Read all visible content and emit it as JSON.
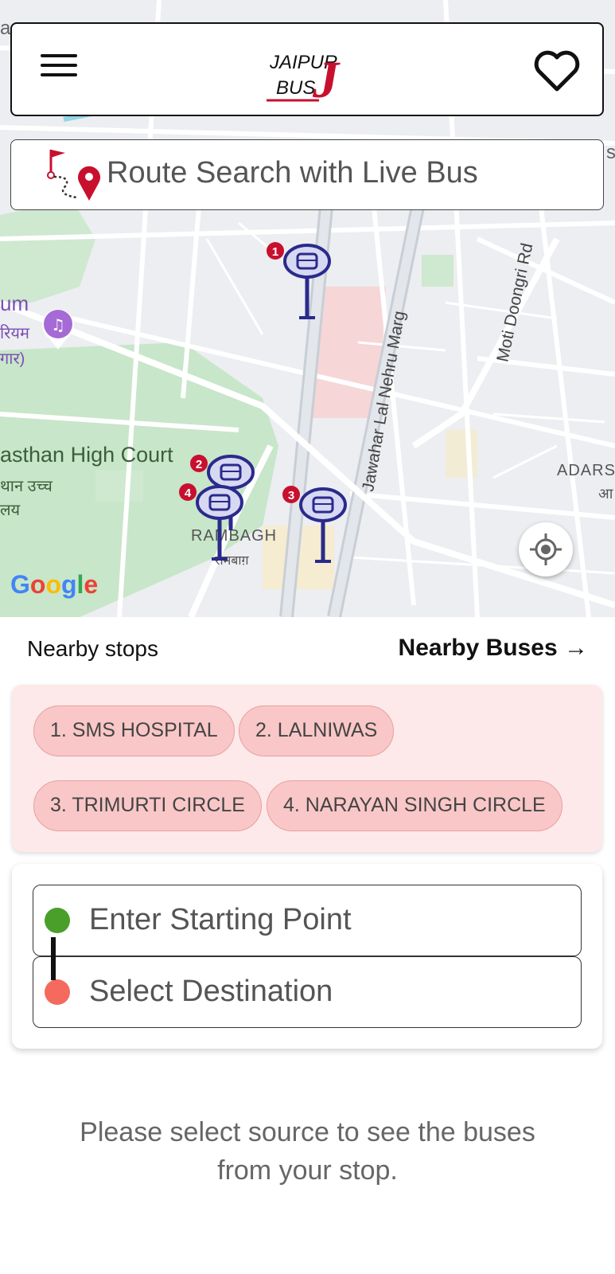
{
  "header": {
    "menu_icon": "hamburger-menu-icon",
    "logo_line1": "JAIPUR",
    "logo_line2": "BUS",
    "logo_mark": "J",
    "favorite_icon": "heart-icon"
  },
  "search": {
    "label": "Route Search with Live Bus",
    "icon": "route-pin-icon"
  },
  "map": {
    "labels": {
      "court": "asthan High Court",
      "court_hindi_1": "थान उच्च",
      "court_hindi_2": "लय",
      "museum": "um",
      "museum_hindi_1": "रियम",
      "museum_hindi_2": "गार)",
      "road1": "Jawahar Lal Nehru Marg",
      "road2": "Moti Doongri Rd",
      "area": "RAMBAGH",
      "area_hindi": "रामबाग़",
      "adarsh": "ADARS",
      "adarsh_hindi": "आ",
      "edge_top": "a",
      "edge_right": "s"
    },
    "markers": [
      "1",
      "2",
      "3",
      "4"
    ],
    "attribution": "Google",
    "locate_icon": "my-location-icon",
    "colors": {
      "marker_blue": "#2a2a8c",
      "marker_red": "#c8102e",
      "park": "#c8e6c9"
    }
  },
  "nearby": {
    "stops_label": "Nearby stops",
    "buses_label": "Nearby Buses",
    "buses_arrow": "→",
    "stops": [
      "1. SMS HOSPITAL",
      "2. LALNIWAS",
      "3. TRIMURTI CIRCLE",
      "4. NARAYAN SINGH CIRCLE"
    ]
  },
  "route": {
    "start_placeholder": "Enter Starting Point",
    "destination_placeholder": "Select Destination",
    "colors": {
      "start": "#4a9f2a",
      "destination": "#f46a5e"
    }
  },
  "message": {
    "line1": "Please select source to see the buses",
    "line2": "from your stop."
  }
}
